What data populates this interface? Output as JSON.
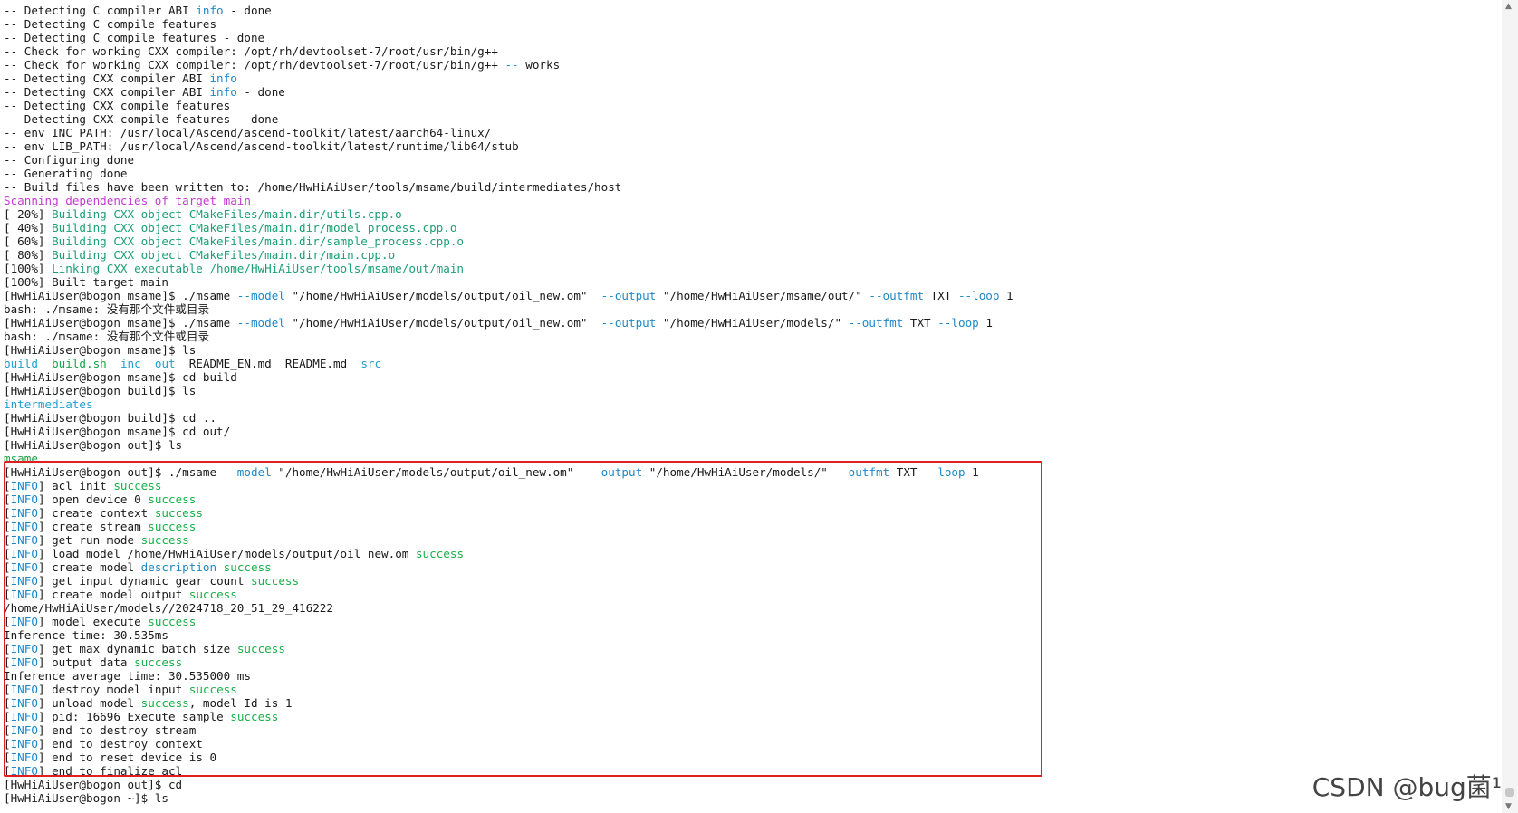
{
  "watermark": "CSDN @bug菌¹",
  "lines": [
    [
      {
        "t": "-- Detecting C compiler ABI ",
        "c": "default"
      },
      {
        "t": "info",
        "c": "blue"
      },
      {
        "t": " - done",
        "c": "default"
      }
    ],
    [
      {
        "t": "-- Detecting C compile features",
        "c": "default"
      }
    ],
    [
      {
        "t": "-- Detecting C compile features - done",
        "c": "default"
      }
    ],
    [
      {
        "t": "-- Check for working CXX compiler: /opt/rh/devtoolset-7/root/usr/bin/g++",
        "c": "default"
      }
    ],
    [
      {
        "t": "-- Check for working CXX compiler: /opt/rh/devtoolset-7/root/usr/bin/g++ ",
        "c": "default"
      },
      {
        "t": "--",
        "c": "blue"
      },
      {
        "t": " works",
        "c": "default"
      }
    ],
    [
      {
        "t": "-- Detecting CXX compiler ABI ",
        "c": "default"
      },
      {
        "t": "info",
        "c": "blue"
      }
    ],
    [
      {
        "t": "-- Detecting CXX compiler ABI ",
        "c": "default"
      },
      {
        "t": "info",
        "c": "blue"
      },
      {
        "t": " - done",
        "c": "default"
      }
    ],
    [
      {
        "t": "-- Detecting CXX compile features",
        "c": "default"
      }
    ],
    [
      {
        "t": "-- Detecting CXX compile features - done",
        "c": "default"
      }
    ],
    [
      {
        "t": "-- env INC_PATH: /usr/local/Ascend/ascend-toolkit/latest/aarch64-linux/",
        "c": "default"
      }
    ],
    [
      {
        "t": "-- env LIB_PATH: /usr/local/Ascend/ascend-toolkit/latest/runtime/lib64/stub",
        "c": "default"
      }
    ],
    [
      {
        "t": "-- Configuring done",
        "c": "default"
      }
    ],
    [
      {
        "t": "-- Generating done",
        "c": "default"
      }
    ],
    [
      {
        "t": "-- Build files have been written to: /home/HwHiAiUser/tools/msame/build/intermediates/host",
        "c": "default"
      }
    ],
    [
      {
        "t": "Scanning dependencies of target main",
        "c": "magenta"
      }
    ],
    [
      {
        "t": "[ 20%] ",
        "c": "default"
      },
      {
        "t": "Building CXX object CMakeFiles/main.dir/utils.cpp.o",
        "c": "teal"
      }
    ],
    [
      {
        "t": "[ 40%] ",
        "c": "default"
      },
      {
        "t": "Building CXX object CMakeFiles/main.dir/model_process.cpp.o",
        "c": "teal"
      }
    ],
    [
      {
        "t": "[ 60%] ",
        "c": "default"
      },
      {
        "t": "Building CXX object CMakeFiles/main.dir/sample_process.cpp.o",
        "c": "teal"
      }
    ],
    [
      {
        "t": "[ 80%] ",
        "c": "default"
      },
      {
        "t": "Building CXX object CMakeFiles/main.dir/main.cpp.o",
        "c": "teal"
      }
    ],
    [
      {
        "t": "[100%] ",
        "c": "default"
      },
      {
        "t": "Linking CXX executable /home/HwHiAiUser/tools/msame/out/main",
        "c": "teal"
      }
    ],
    [
      {
        "t": "[100%] Built target main",
        "c": "default"
      }
    ],
    [
      {
        "t": "[HwHiAiUser@bogon msame]$ ./msame ",
        "c": "default"
      },
      {
        "t": "--model",
        "c": "blue"
      },
      {
        "t": " \"/home/HwHiAiUser/models/output/oil_new.om\"  ",
        "c": "default"
      },
      {
        "t": "--output",
        "c": "blue"
      },
      {
        "t": " \"/home/HwHiAiUser/msame/out/\" ",
        "c": "default"
      },
      {
        "t": "--outfmt",
        "c": "blue"
      },
      {
        "t": " TXT ",
        "c": "default"
      },
      {
        "t": "--loop",
        "c": "blue"
      },
      {
        "t": " 1",
        "c": "default"
      }
    ],
    [
      {
        "t": "bash: ./msame: 没有那个文件或目录",
        "c": "default"
      }
    ],
    [
      {
        "t": "[HwHiAiUser@bogon msame]$ ./msame ",
        "c": "default"
      },
      {
        "t": "--model",
        "c": "blue"
      },
      {
        "t": " \"/home/HwHiAiUser/models/output/oil_new.om\"  ",
        "c": "default"
      },
      {
        "t": "--output",
        "c": "blue"
      },
      {
        "t": " \"/home/HwHiAiUser/models/\" ",
        "c": "default"
      },
      {
        "t": "--outfmt",
        "c": "blue"
      },
      {
        "t": " TXT ",
        "c": "default"
      },
      {
        "t": "--loop",
        "c": "blue"
      },
      {
        "t": " 1",
        "c": "default"
      }
    ],
    [
      {
        "t": "bash: ./msame: 没有那个文件或目录",
        "c": "default"
      }
    ],
    [
      {
        "t": "[HwHiAiUser@bogon msame]$ ls",
        "c": "default"
      }
    ],
    [
      {
        "t": "build",
        "c": "dir"
      },
      {
        "t": "  ",
        "c": "default"
      },
      {
        "t": "build.sh",
        "c": "exe"
      },
      {
        "t": "  ",
        "c": "default"
      },
      {
        "t": "inc",
        "c": "dir"
      },
      {
        "t": "  ",
        "c": "default"
      },
      {
        "t": "out",
        "c": "dir"
      },
      {
        "t": "  README_EN.md  README.md  ",
        "c": "default"
      },
      {
        "t": "src",
        "c": "dir"
      }
    ],
    [
      {
        "t": "[HwHiAiUser@bogon msame]$ cd build",
        "c": "default"
      }
    ],
    [
      {
        "t": "[HwHiAiUser@bogon build]$ ls",
        "c": "default"
      }
    ],
    [
      {
        "t": "intermediates",
        "c": "dir"
      }
    ],
    [
      {
        "t": "[HwHiAiUser@bogon build]$ cd ..",
        "c": "default"
      }
    ],
    [
      {
        "t": "[HwHiAiUser@bogon msame]$ cd out/",
        "c": "default"
      }
    ],
    [
      {
        "t": "[HwHiAiUser@bogon out]$ ls",
        "c": "default"
      }
    ],
    [
      {
        "t": "msame",
        "c": "exe"
      }
    ],
    [
      {
        "t": "[HwHiAiUser@bogon out]$ ./msame ",
        "c": "default"
      },
      {
        "t": "--model",
        "c": "blue"
      },
      {
        "t": " \"/home/HwHiAiUser/models/output/oil_new.om\"  ",
        "c": "default"
      },
      {
        "t": "--output",
        "c": "blue"
      },
      {
        "t": " \"/home/HwHiAiUser/models/\" ",
        "c": "default"
      },
      {
        "t": "--outfmt",
        "c": "blue"
      },
      {
        "t": " TXT ",
        "c": "default"
      },
      {
        "t": "--loop",
        "c": "blue"
      },
      {
        "t": " 1",
        "c": "default"
      }
    ],
    [
      {
        "t": "[",
        "c": "default"
      },
      {
        "t": "INFO",
        "c": "blue"
      },
      {
        "t": "] acl init ",
        "c": "default"
      },
      {
        "t": "success",
        "c": "green"
      }
    ],
    [
      {
        "t": "[",
        "c": "default"
      },
      {
        "t": "INFO",
        "c": "blue"
      },
      {
        "t": "] open device 0 ",
        "c": "default"
      },
      {
        "t": "success",
        "c": "green"
      }
    ],
    [
      {
        "t": "[",
        "c": "default"
      },
      {
        "t": "INFO",
        "c": "blue"
      },
      {
        "t": "] create context ",
        "c": "default"
      },
      {
        "t": "success",
        "c": "green"
      }
    ],
    [
      {
        "t": "[",
        "c": "default"
      },
      {
        "t": "INFO",
        "c": "blue"
      },
      {
        "t": "] create stream ",
        "c": "default"
      },
      {
        "t": "success",
        "c": "green"
      }
    ],
    [
      {
        "t": "[",
        "c": "default"
      },
      {
        "t": "INFO",
        "c": "blue"
      },
      {
        "t": "] get run mode ",
        "c": "default"
      },
      {
        "t": "success",
        "c": "green"
      }
    ],
    [
      {
        "t": "[",
        "c": "default"
      },
      {
        "t": "INFO",
        "c": "blue"
      },
      {
        "t": "] load model /home/HwHiAiUser/models/output/oil_new.om ",
        "c": "default"
      },
      {
        "t": "success",
        "c": "green"
      }
    ],
    [
      {
        "t": "[",
        "c": "default"
      },
      {
        "t": "INFO",
        "c": "blue"
      },
      {
        "t": "] create model ",
        "c": "default"
      },
      {
        "t": "description",
        "c": "blue"
      },
      {
        "t": " ",
        "c": "default"
      },
      {
        "t": "success",
        "c": "green"
      }
    ],
    [
      {
        "t": "[",
        "c": "default"
      },
      {
        "t": "INFO",
        "c": "blue"
      },
      {
        "t": "] get input dynamic gear count ",
        "c": "default"
      },
      {
        "t": "success",
        "c": "green"
      }
    ],
    [
      {
        "t": "[",
        "c": "default"
      },
      {
        "t": "INFO",
        "c": "blue"
      },
      {
        "t": "] create model output ",
        "c": "default"
      },
      {
        "t": "success",
        "c": "green"
      }
    ],
    [
      {
        "t": "/home/HwHiAiUser/models//2024718_20_51_29_416222",
        "c": "default"
      }
    ],
    [
      {
        "t": "[",
        "c": "default"
      },
      {
        "t": "INFO",
        "c": "blue"
      },
      {
        "t": "] model execute ",
        "c": "default"
      },
      {
        "t": "success",
        "c": "green"
      }
    ],
    [
      {
        "t": "Inference time: 30.535ms",
        "c": "default"
      }
    ],
    [
      {
        "t": "[",
        "c": "default"
      },
      {
        "t": "INFO",
        "c": "blue"
      },
      {
        "t": "] get max dynamic batch size ",
        "c": "default"
      },
      {
        "t": "success",
        "c": "green"
      }
    ],
    [
      {
        "t": "[",
        "c": "default"
      },
      {
        "t": "INFO",
        "c": "blue"
      },
      {
        "t": "] output data ",
        "c": "default"
      },
      {
        "t": "success",
        "c": "green"
      }
    ],
    [
      {
        "t": "Inference average time: 30.535000 ms",
        "c": "default"
      }
    ],
    [
      {
        "t": "[",
        "c": "default"
      },
      {
        "t": "INFO",
        "c": "blue"
      },
      {
        "t": "] destroy model input ",
        "c": "default"
      },
      {
        "t": "success",
        "c": "green"
      }
    ],
    [
      {
        "t": "[",
        "c": "default"
      },
      {
        "t": "INFO",
        "c": "blue"
      },
      {
        "t": "] unload model ",
        "c": "default"
      },
      {
        "t": "success",
        "c": "green"
      },
      {
        "t": ", model Id is 1",
        "c": "default"
      }
    ],
    [
      {
        "t": "[",
        "c": "default"
      },
      {
        "t": "INFO",
        "c": "blue"
      },
      {
        "t": "] pid: 16696 Execute sample ",
        "c": "default"
      },
      {
        "t": "success",
        "c": "green"
      }
    ],
    [
      {
        "t": "[",
        "c": "default"
      },
      {
        "t": "INFO",
        "c": "blue"
      },
      {
        "t": "] end to destroy stream",
        "c": "default"
      }
    ],
    [
      {
        "t": "[",
        "c": "default"
      },
      {
        "t": "INFO",
        "c": "blue"
      },
      {
        "t": "] end to destroy context",
        "c": "default"
      }
    ],
    [
      {
        "t": "[",
        "c": "default"
      },
      {
        "t": "INFO",
        "c": "blue"
      },
      {
        "t": "] end to reset device is 0",
        "c": "default"
      }
    ],
    [
      {
        "t": "[",
        "c": "default"
      },
      {
        "t": "INFO",
        "c": "blue"
      },
      {
        "t": "] end to finalize acl",
        "c": "default"
      }
    ],
    [
      {
        "t": "[HwHiAiUser@bogon out]$ cd",
        "c": "default"
      }
    ],
    [
      {
        "t": "[HwHiAiUser@bogon ~]$ ls",
        "c": "default"
      }
    ]
  ]
}
